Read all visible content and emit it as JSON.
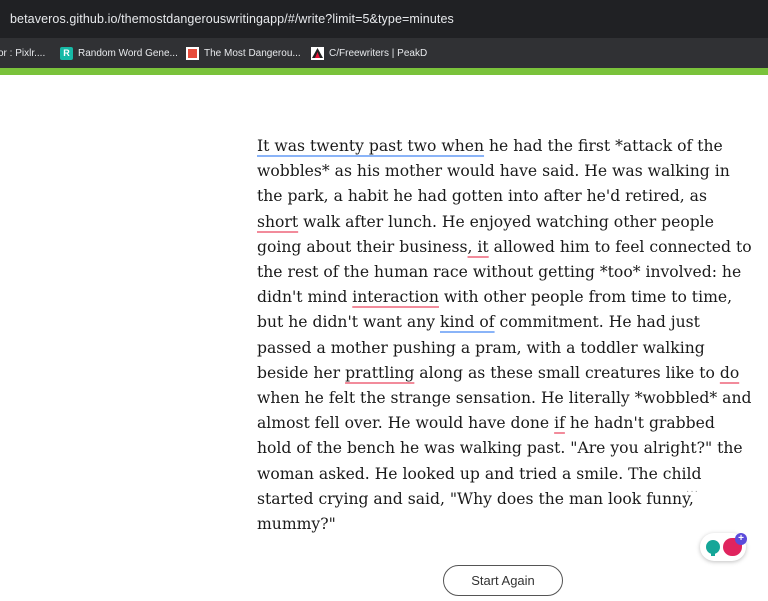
{
  "browser": {
    "url": "betaveros.github.io/themostdangerouswritingapp/#/write?limit=5&type=minutes",
    "bookmarks": [
      {
        "label": "or : Pixlr....",
        "icon": "none"
      },
      {
        "label": "Random Word Gene...",
        "icon": "r-icon"
      },
      {
        "label": "The Most Dangerou...",
        "icon": "red-square-icon"
      },
      {
        "label": "C/Freewriters | PeakD",
        "icon": "peakd-icon"
      }
    ],
    "progress_fraction": 1.0,
    "progress_color": "#7ac23b"
  },
  "editor": {
    "text_segments": [
      {
        "text": "It was twenty past two when",
        "mark": "gram"
      },
      {
        "text": " he had the first *attack of the wobbles* as his mother would have said. He was walking in the park, a habit he had gotten into after he'd retired, as ",
        "mark": ""
      },
      {
        "text": "short",
        "mark": "spell"
      },
      {
        "text": " walk after lunch. He enjoyed watching other people going about their business",
        "mark": ""
      },
      {
        "text": ", it",
        "mark": "spell"
      },
      {
        "text": " allowed him to feel connected to the rest of the human race without getting *too* involved: he didn't mind ",
        "mark": ""
      },
      {
        "text": "interaction",
        "mark": "spell"
      },
      {
        "text": " with other people from time to time, but he didn't want any ",
        "mark": ""
      },
      {
        "text": "kind of",
        "mark": "gram"
      },
      {
        "text": " commitment. He had just passed a mother pushing a pram, with a toddler walking beside her ",
        "mark": ""
      },
      {
        "text": "prattling",
        "mark": "spell"
      },
      {
        "text": " along as these small creatures like to ",
        "mark": ""
      },
      {
        "text": "do",
        "mark": "spell"
      },
      {
        "text": " when he felt the strange sensation. He literally *wobbled* and almost fell over. He would have done ",
        "mark": ""
      },
      {
        "text": "if",
        "mark": "spell"
      },
      {
        "text": " he hadn't grabbed hold of the bench he was walking past. \"Are you alright?\" the woman asked. He looked up and tried a smile. The child started crying and said, \"Why does the man look funny, mummy?\"",
        "mark": ""
      }
    ]
  },
  "extension": {
    "plus_label": "+"
  },
  "actions": {
    "start_again_label": "Start Again"
  }
}
